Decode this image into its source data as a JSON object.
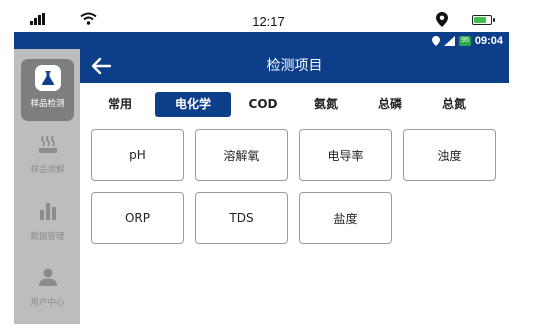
{
  "phone_status": {
    "time": "12:17"
  },
  "device_status": {
    "time": "09:04",
    "network_badge": "95"
  },
  "header": {
    "title": "检测项目"
  },
  "sidebar": {
    "items": [
      {
        "label": "样品检测",
        "icon": "flask-icon",
        "active": true
      },
      {
        "label": "样品消解",
        "icon": "heater-icon",
        "active": false
      },
      {
        "label": "数据管理",
        "icon": "bar-chart-icon",
        "active": false
      },
      {
        "label": "用户中心",
        "icon": "user-icon",
        "active": false
      }
    ]
  },
  "tabs": [
    {
      "label": "常用",
      "active": false
    },
    {
      "label": "电化学",
      "active": true
    },
    {
      "label": "COD",
      "active": false
    },
    {
      "label": "氨氮",
      "active": false
    },
    {
      "label": "总磷",
      "active": false
    },
    {
      "label": "总氮",
      "active": false
    }
  ],
  "items": [
    {
      "label": "pH"
    },
    {
      "label": "溶解氧"
    },
    {
      "label": "电导率"
    },
    {
      "label": "浊度"
    },
    {
      "label": "ORP"
    },
    {
      "label": "TDS"
    },
    {
      "label": "盐度"
    }
  ],
  "colors": {
    "primary": "#0d3e8a",
    "sidebar_bg": "#bdbdbd",
    "sidebar_active": "#7e7e7e"
  }
}
